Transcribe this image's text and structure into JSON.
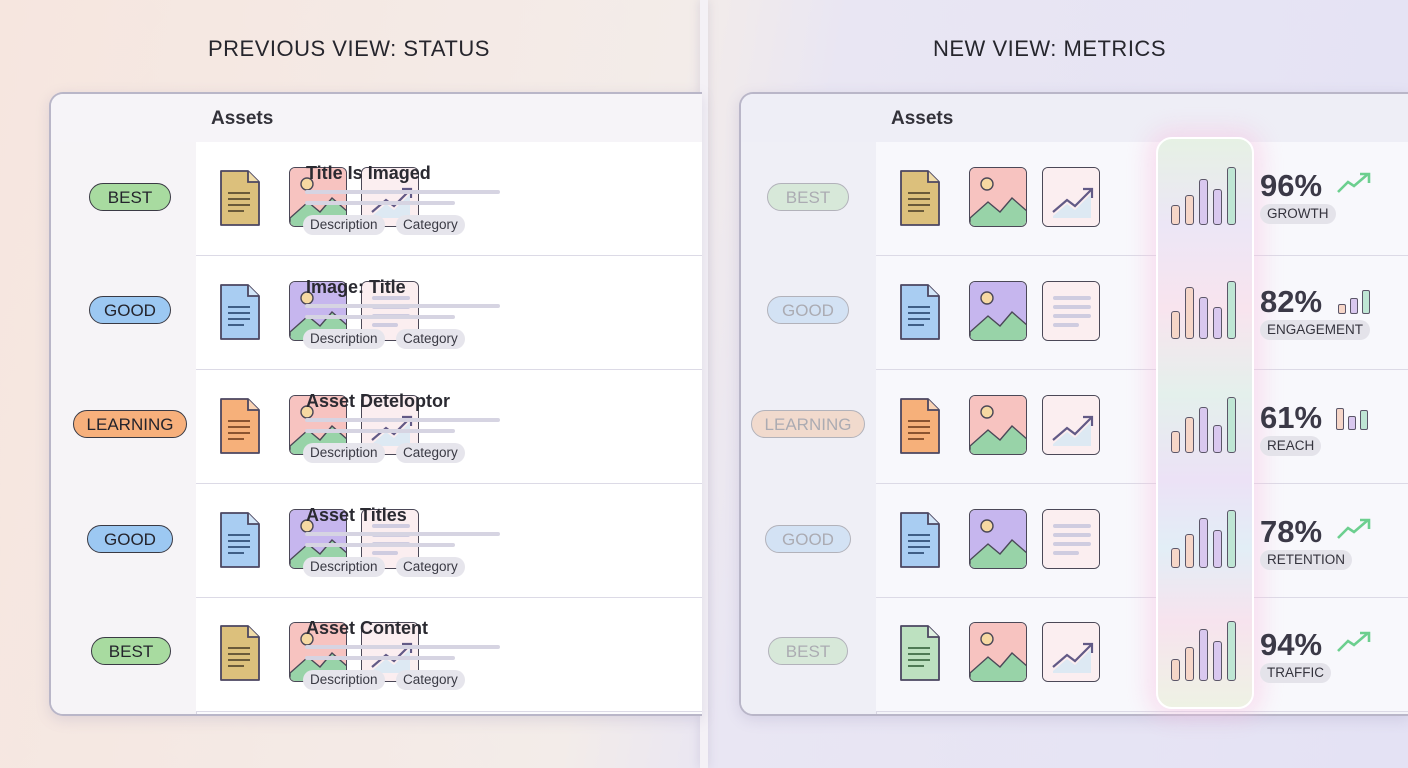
{
  "left": {
    "heading": "PREVIOUS VIEW: STATUS",
    "panel_title": "Assets",
    "rows": [
      {
        "status": "BEST",
        "title": "Title Is Imaged",
        "tag1": "Description",
        "tag2": "Category"
      },
      {
        "status": "GOOD",
        "title": "Image: Title",
        "tag1": "Description",
        "tag2": "Category"
      },
      {
        "status": "LEARNING",
        "title": "Asset Deteloptor",
        "tag1": "Description",
        "tag2": "Category"
      },
      {
        "status": "GOOD",
        "title": "Asset Titles",
        "tag1": "Description",
        "tag2": "Category"
      },
      {
        "status": "BEST",
        "title": "Asset Content",
        "tag1": "Description",
        "tag2": "Category"
      }
    ]
  },
  "right": {
    "heading": "NEW VIEW: METRICS",
    "panel_title": "Assets",
    "rows": [
      {
        "status": "BEST",
        "percent": "96%",
        "label": "GROWTH",
        "trend": "up-arrow-icon"
      },
      {
        "status": "GOOD",
        "percent": "82%",
        "label": "ENGAGEMENT",
        "trend": "mini-bar-chart-icon"
      },
      {
        "status": "LEARNING",
        "percent": "61%",
        "label": "REACH",
        "trend": "mini-bar-chart-icon"
      },
      {
        "status": "GOOD",
        "percent": "78%",
        "label": "RETENTION",
        "trend": "up-arrow-icon"
      },
      {
        "status": "BEST",
        "percent": "94%",
        "label": "TRAFFIC",
        "trend": "up-arrow-icon"
      }
    ]
  },
  "colors": {
    "best": "#a8dba0",
    "good": "#9cc8f2",
    "learning": "#f7b07c",
    "doc_gold": "#dcc07c",
    "doc_blue": "#a9cdf2",
    "doc_orange": "#f6b07a",
    "doc_green": "#bde1c0"
  }
}
